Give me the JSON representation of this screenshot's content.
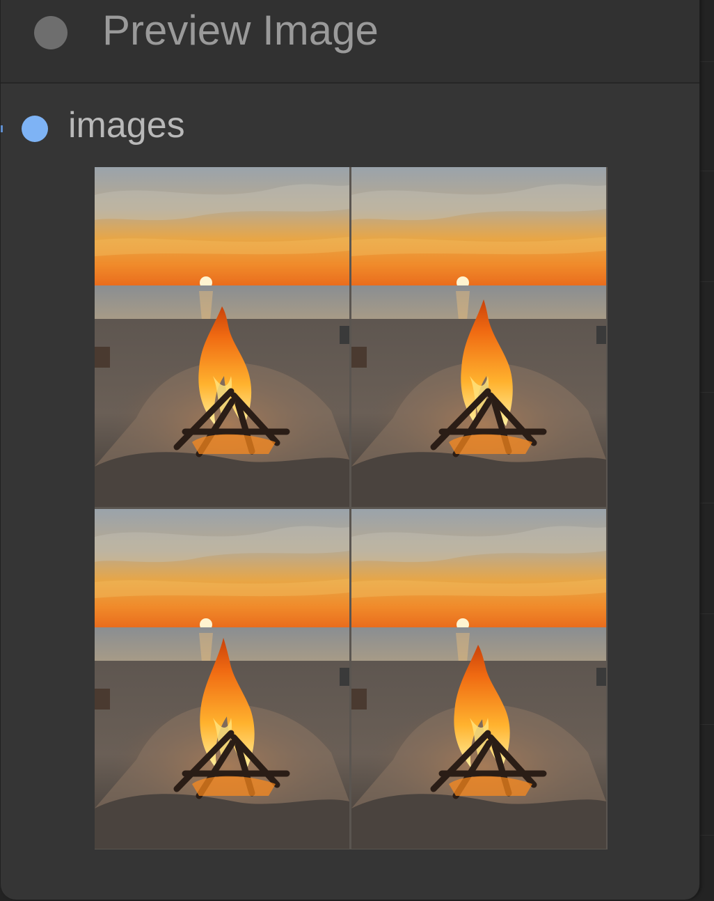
{
  "node": {
    "title": "Preview Image",
    "input_label": "images",
    "slot_color": "#7eb3f5",
    "collapse_color": "#6e6e6e"
  },
  "preview": {
    "image_count": 4,
    "images": [
      {
        "subject": "beach campfire at sunset"
      },
      {
        "subject": "beach campfire at sunset"
      },
      {
        "subject": "beach campfire at sunset"
      },
      {
        "subject": "beach campfire at sunset"
      }
    ]
  }
}
